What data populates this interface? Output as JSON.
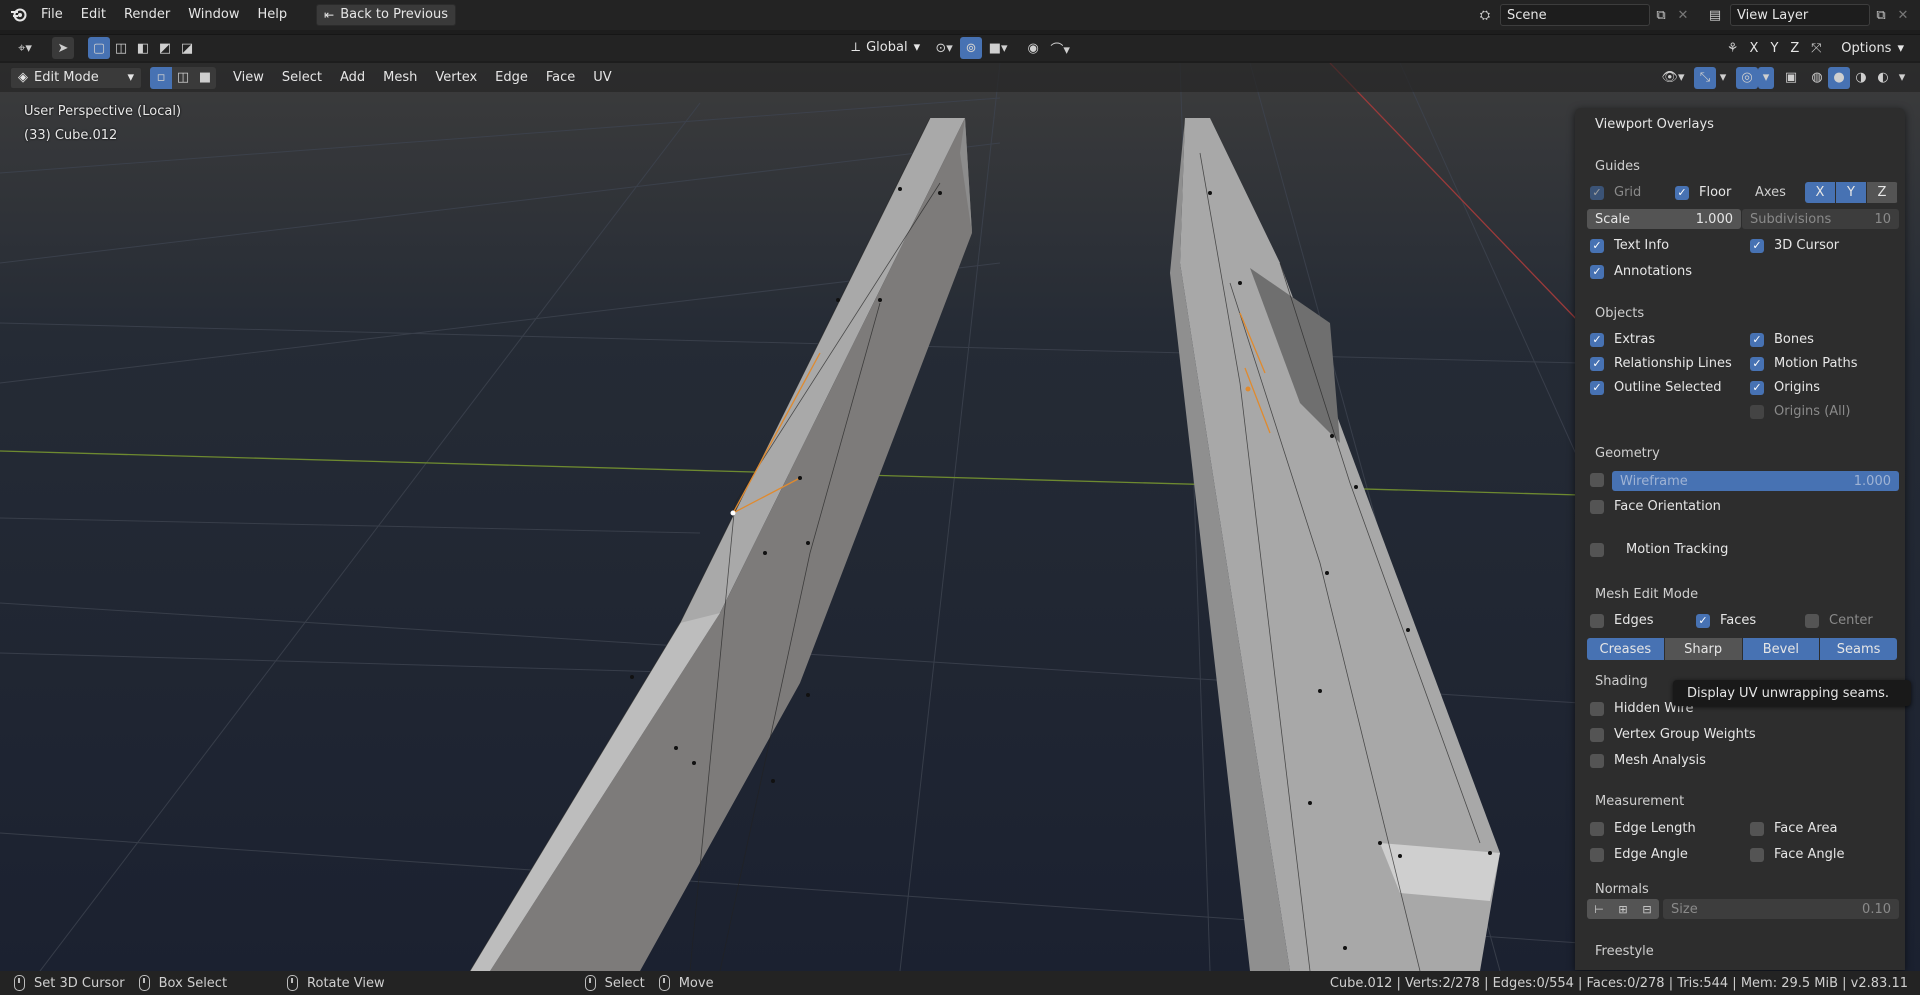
{
  "topbar": {
    "menus": [
      "File",
      "Edit",
      "Render",
      "Window",
      "Help"
    ],
    "back_button": "Back to Previous",
    "scene_name": "Scene",
    "view_layer": "View Layer"
  },
  "toolbar": {
    "orientation": "Global",
    "axes": [
      "X",
      "Y",
      "Z"
    ],
    "options": "Options"
  },
  "header": {
    "mode": "Edit Mode",
    "menus": [
      "View",
      "Select",
      "Add",
      "Mesh",
      "Vertex",
      "Edge",
      "Face",
      "UV"
    ]
  },
  "viewport": {
    "view_name": "User Perspective (Local)",
    "object_name": "(33) Cube.012"
  },
  "overlays": {
    "title": "Viewport Overlays",
    "guides": {
      "heading": "Guides",
      "grid": "Grid",
      "floor": "Floor",
      "axes_label": "Axes",
      "axes": [
        "X",
        "Y",
        "Z"
      ],
      "scale_label": "Scale",
      "scale_value": "1.000",
      "subdivisions_label": "Subdivisions",
      "subdivisions_value": "10",
      "text_info": "Text Info",
      "cursor_3d": "3D Cursor",
      "annotations": "Annotations"
    },
    "objects": {
      "heading": "Objects",
      "extras": "Extras",
      "bones": "Bones",
      "relationship_lines": "Relationship Lines",
      "motion_paths": "Motion Paths",
      "outline_selected": "Outline Selected",
      "origins": "Origins",
      "origins_all": "Origins (All)"
    },
    "geometry": {
      "heading": "Geometry",
      "wireframe_label": "Wireframe",
      "wireframe_value": "1.000",
      "face_orientation": "Face Orientation"
    },
    "motion_tracking": "Motion Tracking",
    "mesh_edit": {
      "heading": "Mesh Edit Mode",
      "edges": "Edges",
      "faces": "Faces",
      "center": "Center",
      "buttons": [
        "Creases",
        "Sharp",
        "Bevel",
        "Seams"
      ]
    },
    "shading": {
      "heading": "Shading",
      "hidden_wire": "Hidden Wire",
      "vertex_group_weights": "Vertex Group Weights",
      "mesh_analysis": "Mesh Analysis"
    },
    "measurement": {
      "heading": "Measurement",
      "edge_length": "Edge Length",
      "face_area": "Face Area",
      "edge_angle": "Edge Angle",
      "face_angle": "Face Angle"
    },
    "normals": {
      "heading": "Normals",
      "size_label": "Size",
      "size_value": "0.10"
    },
    "freestyle": "Freestyle"
  },
  "tooltip": "Display UV unwrapping seams.",
  "statusbar": {
    "set_cursor": "Set 3D Cursor",
    "box_select": "Box Select",
    "rotate_view": "Rotate View",
    "select": "Select",
    "move": "Move",
    "stats": "Cube.012 | Verts:2/278 | Edges:0/554 | Faces:0/278 | Tris:544 | Mem: 29.5 MiB | v2.83.11"
  },
  "colors": {
    "accent": "#4772b3",
    "panel_bg": "#2d2d2d",
    "header_bg": "#232323",
    "viewport_bg": "#393939"
  }
}
